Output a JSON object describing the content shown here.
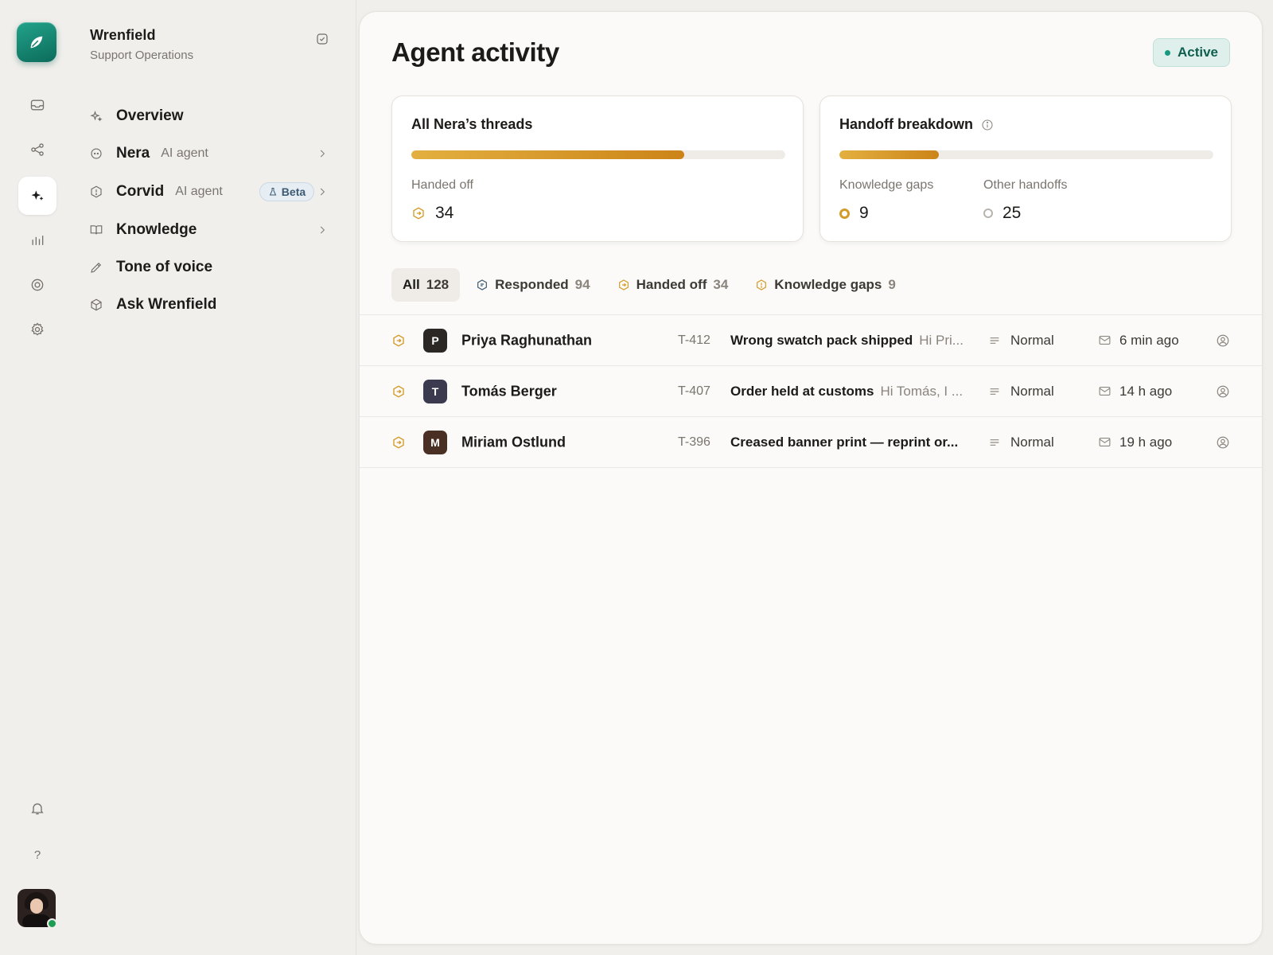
{
  "workspace": {
    "name": "Wrenfield",
    "subtitle": "Support Operations"
  },
  "nav": [
    {
      "label": "Overview",
      "sub": "",
      "badge": "",
      "icon": "sparkle-icon"
    },
    {
      "label": "Nera",
      "sub": "AI agent",
      "badge": "",
      "icon": "bot-icon"
    },
    {
      "label": "Corvid",
      "sub": "AI agent",
      "badge": "Beta",
      "icon": "shield-icon"
    },
    {
      "label": "Knowledge",
      "sub": "",
      "badge": "",
      "icon": "book-icon"
    },
    {
      "label": "Tone of voice",
      "sub": "",
      "badge": "",
      "icon": "pen-icon"
    },
    {
      "label": "Ask Wrenfield",
      "sub": "",
      "badge": "",
      "icon": "cube-icon"
    }
  ],
  "rail": {
    "items": [
      "inbox-icon",
      "share-icon",
      "sparkles-icon",
      "chart-icon",
      "target-icon",
      "gear-icon"
    ],
    "help": "?"
  },
  "header": {
    "title": "Agent activity",
    "status": "Active"
  },
  "cards": {
    "threads": {
      "title": "All Nera’s threads",
      "fill_fraction": 0.73,
      "stat_label": "Handed off",
      "stat_value": "34"
    },
    "handoff": {
      "title": "Handoff breakdown",
      "fill_fraction": 0.265,
      "stats": [
        {
          "label": "Knowledge gaps",
          "value": "9"
        },
        {
          "label": "Other handoffs",
          "value": "25"
        }
      ]
    }
  },
  "tabs": [
    {
      "label": "All",
      "count": "128"
    },
    {
      "label": "Responded",
      "count": "94"
    },
    {
      "label": "Handed off",
      "count": "34"
    },
    {
      "label": "Knowledge gaps",
      "count": "9"
    }
  ],
  "rows": [
    {
      "initial": "P",
      "avatar_color": "#2a2725",
      "name": "Priya Raghunathan",
      "ticket": "T-412",
      "subject": "Wrong swatch pack shipped",
      "preview": "Hi Pri...",
      "priority": "Normal",
      "time": "6 min ago"
    },
    {
      "initial": "T",
      "avatar_color": "#3b3a4f",
      "name": "Tomás Berger",
      "ticket": "T-407",
      "subject": "Order held at customs",
      "preview": "Hi Tomás, I ...",
      "priority": "Normal",
      "time": "14 h ago"
    },
    {
      "initial": "M",
      "avatar_color": "#4a2f25",
      "name": "Miriam Ostlund",
      "ticket": "T-396",
      "subject": "Creased banner print — reprint or...",
      "preview": "",
      "priority": "Normal",
      "time": "19 h ago"
    }
  ]
}
